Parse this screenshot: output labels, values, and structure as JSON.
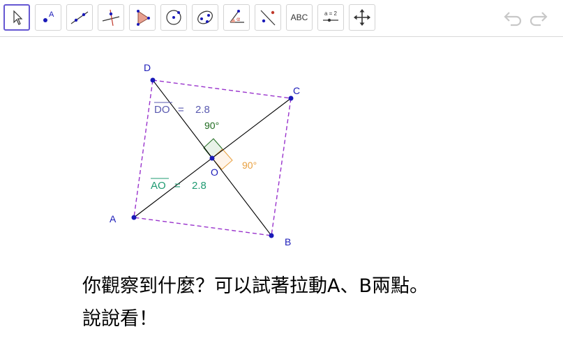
{
  "toolbar": {
    "tools": [
      {
        "name": "move-tool-icon"
      },
      {
        "name": "point-tool-icon",
        "label": "A"
      },
      {
        "name": "line-tool-icon"
      },
      {
        "name": "perpendicular-line-tool-icon"
      },
      {
        "name": "polygon-tool-icon"
      },
      {
        "name": "circle-tool-icon"
      },
      {
        "name": "ellipse-tool-icon"
      },
      {
        "name": "angle-tool-icon",
        "label": "α"
      },
      {
        "name": "reflect-tool-icon"
      },
      {
        "name": "text-tool-icon",
        "label": "ABC"
      },
      {
        "name": "slider-tool-icon",
        "label": "a = 2"
      },
      {
        "name": "move-graphics-view-tool-icon"
      }
    ],
    "undo": "undo-icon",
    "redo": "redo-icon"
  },
  "figure": {
    "points": {
      "A": "A",
      "B": "B",
      "C": "C",
      "D": "D",
      "O": "O"
    },
    "do_label": {
      "segment": "DO",
      "eq": "=",
      "value": "2.8"
    },
    "ao_label": {
      "segment": "AO",
      "eq": "=",
      "value": "2.8"
    },
    "angle1": "90°",
    "angle2": "90°",
    "colors": {
      "point": "#1a1ab8",
      "dashed_square": "#9933cc",
      "do_label": "#5a5ab0",
      "ao_label": "#1f9b72",
      "angle1": "#1f6b1f",
      "angle2": "#e8a040"
    }
  },
  "question": {
    "line1": "你觀察到什麼？可以試著拉動A、B兩點。",
    "line2": "說說看！"
  }
}
